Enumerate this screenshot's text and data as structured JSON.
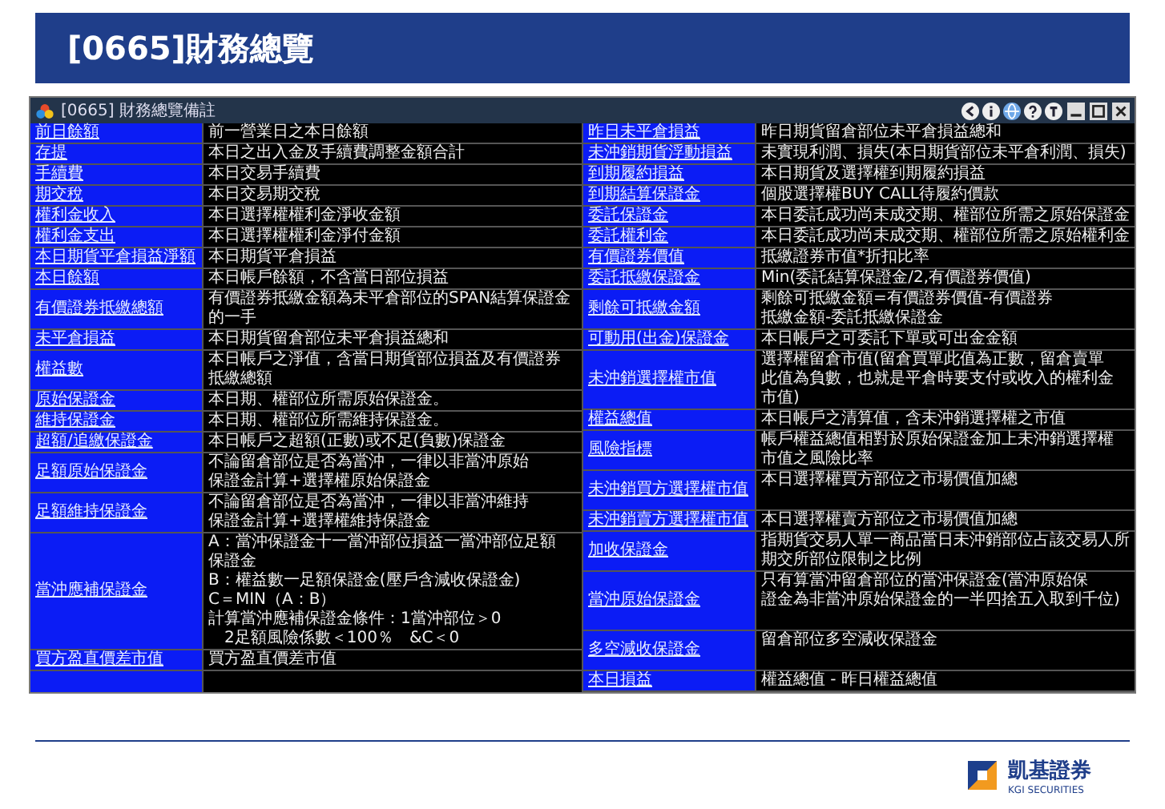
{
  "slide_title": "[0665]財務總覽",
  "window": {
    "title": "[0665] 財務總覽備註"
  },
  "left_rows": [
    {
      "label": "前日餘額",
      "lines": [
        "前一營業日之本日餘額"
      ]
    },
    {
      "label": "存提",
      "lines": [
        "本日之出入金及手續費調整金額合計"
      ]
    },
    {
      "label": "手續費",
      "lines": [
        "本日交易手續費"
      ]
    },
    {
      "label": "期交稅",
      "lines": [
        "本日交易期交稅"
      ]
    },
    {
      "label": "權利金收入",
      "lines": [
        "本日選擇權權利金淨收金額"
      ]
    },
    {
      "label": "權利金支出",
      "lines": [
        "本日選擇權權利金淨付金額"
      ]
    },
    {
      "label": "本日期貨平倉損益淨額",
      "lines": [
        "本日期貨平倉損益"
      ]
    },
    {
      "label": "本日餘額",
      "lines": [
        "本日帳戶餘額，不含當日部位損益"
      ]
    },
    {
      "label": "有價證券抵繳總額",
      "lines": [
        "有價證券抵繳金額為未平倉部位的SPAN結算保證金",
        "的一手"
      ]
    },
    {
      "label": "未平倉損益",
      "lines": [
        "本日期貨留倉部位未平倉損益總和"
      ]
    },
    {
      "label": "權益數",
      "lines": [
        "本日帳戶之淨值，含當日期貨部位損益及有價證券",
        "抵繳總額"
      ]
    },
    {
      "label": "原始保證金",
      "lines": [
        "本日期、權部位所需原始保證金。"
      ]
    },
    {
      "label": "維持保證金",
      "lines": [
        "本日期、權部位所需維持保證金。"
      ]
    },
    {
      "label": "超額/追繳保證金",
      "lines": [
        "本日帳戶之超額(正數)或不足(負數)保證金"
      ]
    },
    {
      "label": "足額原始保證金",
      "lines": [
        "不論留倉部位是否為當沖，一律以非當沖原始",
        "保證金計算+選擇權原始保證金"
      ]
    },
    {
      "label": "足額維持保證金",
      "lines": [
        "不論留倉部位是否為當沖，一律以非當沖維持",
        "保證金計算+選擇權維持保證金"
      ]
    },
    {
      "label": "當沖應補保證金",
      "lines": [
        "A：當沖保證金十一當沖部位損益一當沖部位足額",
        "保證金",
        "B：權益數一足額保證金(壓戶含減收保證金)",
        "C＝MIN（A：B）",
        "計算當沖應補保證金條件：1當沖部位＞0",
        "　2足額風險係數＜100％　&C＜0"
      ]
    },
    {
      "label": "買方盈直價差市值",
      "lines": [
        "買方盈直價差市值"
      ]
    }
  ],
  "right_rows": [
    {
      "label": "昨日未平倉損益",
      "lines": [
        "昨日期貨留倉部位未平倉損益總和"
      ],
      "tall": false
    },
    {
      "label": "未沖銷期貨浮動損益",
      "lines": [
        "未實現利潤、損失(本日期貨部位未平倉利潤、損失)"
      ],
      "tall": false
    },
    {
      "label": "到期履約損益",
      "lines": [
        "本日期貨及選擇權到期履約損益"
      ],
      "tall": false
    },
    {
      "label": "到期結算保證金",
      "lines": [
        "個股選擇權BUY CALL待履約價款"
      ],
      "tall": false
    },
    {
      "label": "委託保證金",
      "lines": [
        "本日委託成功尚未成交期、權部位所需之原始保證金"
      ],
      "tall": false
    },
    {
      "label": "委託權利金",
      "lines": [
        "本日委託成功尚未成交期、權部位所需之原始權利金"
      ],
      "tall": false
    },
    {
      "label": "有價證券價值",
      "lines": [
        "抵繳證券市值*折扣比率"
      ],
      "tall": false
    },
    {
      "label": "委託抵繳保證金",
      "lines": [
        "Min(委託結算保證金/2,有價證券價值)"
      ],
      "tall": false
    },
    {
      "label": "剩餘可抵繳金額",
      "lines": [
        "剩餘可抵繳金額=有價證券價值-有價證券",
        "抵繳金額-委託抵繳保證金"
      ],
      "tall": false
    },
    {
      "label": "可動用(出金)保證金",
      "lines": [
        "本日帳戶之可委託下單或可出金金額"
      ],
      "tall": false
    },
    {
      "label": "未沖銷選擇權市值",
      "lines": [
        "選擇權留倉市值(留倉買單此值為正數，留倉賣單",
        "此值為負數，也就是平倉時要支付或收入的權利金",
        "市值)"
      ],
      "tall": false
    },
    {
      "label": "權益總值",
      "lines": [
        "本日帳戶之清算值，含未沖銷選擇權之市值"
      ],
      "tall": false
    },
    {
      "label": "風險指標",
      "lines": [
        "帳戶權益總值相對於原始保證金加上未沖銷選擇權",
        "市值之風險比率"
      ],
      "tall": false
    },
    {
      "label": "未沖銷買方選擇權市值",
      "lines": [
        "本日選擇權買方部位之市場價值加總"
      ],
      "tall": true
    },
    {
      "label": "未沖銷賣方選擇權市值",
      "lines": [
        "本日選擇權賣方部位之市場價值加總"
      ],
      "tall": false
    },
    {
      "label": "加收保證金",
      "lines": [
        "指期貨交易人單一商品當日未沖銷部位占該交易人所",
        "期交所部位限制之比例"
      ],
      "tall": false
    },
    {
      "label": "當沖原始保證金",
      "lines": [
        "只有算當沖留倉部位的當沖保證金(當沖原始保",
        "證金為非當沖原始保證金的一半四捨五入取到千位)"
      ],
      "tall": true
    },
    {
      "label": "多空減收保證金",
      "lines": [
        "留倉部位多空減收保證金"
      ],
      "tall": true
    },
    {
      "label": "本日損益",
      "lines": [
        "權益總值 - 昨日權益總值"
      ],
      "tall": false
    }
  ],
  "logo": {
    "name": "凱基證券",
    "subtitle": "KGI SECURITIES"
  }
}
